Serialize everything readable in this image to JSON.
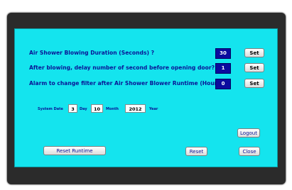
{
  "rows": [
    {
      "label": "Air Shower Blowing Duration (Seconds) ?",
      "value": "30",
      "button": "Set"
    },
    {
      "label": "After blowing, delay number of second before opening door?",
      "value": "1",
      "button": "Set"
    },
    {
      "label": "Alarm to change filter after Air Shower Blower Runtime (Hours)",
      "value": "0",
      "button": "Set"
    }
  ],
  "system_date": {
    "label": "System Date",
    "day": "3",
    "day_label": "Day",
    "month": "10",
    "month_label": "Month",
    "year": "2012",
    "year_label": "Year"
  },
  "buttons": {
    "reset_runtime": "Reset Runtime",
    "reset": "Reset",
    "logout": "Logout",
    "close": "Close"
  }
}
